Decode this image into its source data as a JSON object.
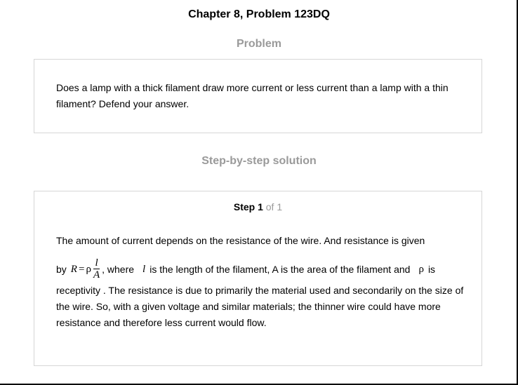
{
  "header": {
    "chapter_title": "Chapter 8, Problem 123DQ"
  },
  "problem": {
    "heading": "Problem",
    "text": "Does a lamp with a thick filament draw more current or less current than a lamp with a thin filament? Defend your answer."
  },
  "solution": {
    "heading": "Step-by-step solution",
    "step": {
      "word": "Step 1",
      "total": "of 1"
    },
    "line1": "The amount of current depends on the resistance of the wire. And resistance is given",
    "formula_line": {
      "by": "by",
      "R": "R",
      "equals": "=",
      "rho": "ρ",
      "numerator": "l",
      "denominator": "A",
      "after_formula": ", where",
      "l_symbol": "l",
      "middle_text": "is the length of the filament, A is the area of the filament and",
      "rho_symbol": "ρ",
      "is_text": "is"
    },
    "paragraph": "receptivity . The resistance is due to primarily the material used and secondarily on the size of the wire. So, with a given voltage and similar materials; the thinner wire could have more resistance and therefore less current would flow."
  }
}
